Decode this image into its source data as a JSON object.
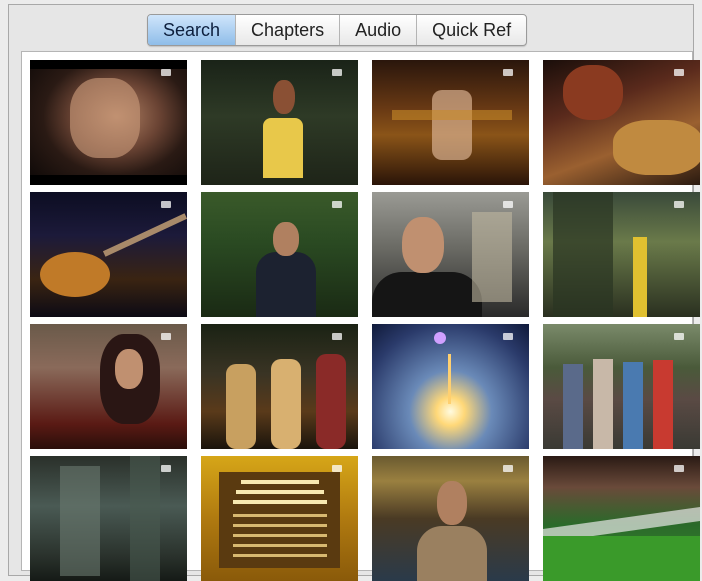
{
  "tabs": [
    {
      "label": "Search",
      "active": true
    },
    {
      "label": "Chapters",
      "active": false
    },
    {
      "label": "Audio",
      "active": false
    },
    {
      "label": "Quick Ref",
      "active": false
    }
  ],
  "thumbnails": {
    "count": 16,
    "columns": 4,
    "rows": 4
  },
  "colors": {
    "active_tab": "#8fbde9",
    "window_bg": "#e6e6e6"
  }
}
